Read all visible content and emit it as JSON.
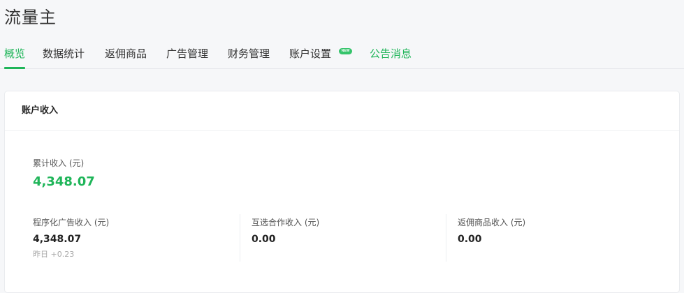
{
  "app": {
    "title": "流量主"
  },
  "tabs": [
    {
      "label": "概览",
      "active": true
    },
    {
      "label": "数据统计",
      "active": false
    },
    {
      "label": "返佣商品",
      "active": false
    },
    {
      "label": "广告管理",
      "active": false
    },
    {
      "label": "财务管理",
      "active": false
    },
    {
      "label": "账户设置",
      "active": false,
      "badge": "NEW"
    },
    {
      "label": "公告消息",
      "active": false
    }
  ],
  "card": {
    "title": "账户收入",
    "total": {
      "label": "累计收入 (元)",
      "value": "4,348.07"
    },
    "breakdown": [
      {
        "label": "程序化广告收入 (元)",
        "value": "4,348.07",
        "extra": "昨日 +0.23"
      },
      {
        "label": "互选合作收入 (元)",
        "value": "0.00"
      },
      {
        "label": "返佣商品收入 (元)",
        "value": "0.00"
      }
    ]
  },
  "colors": {
    "accent": "#1fb559",
    "badge": "#35c46b",
    "background": "#f6f7f9"
  }
}
